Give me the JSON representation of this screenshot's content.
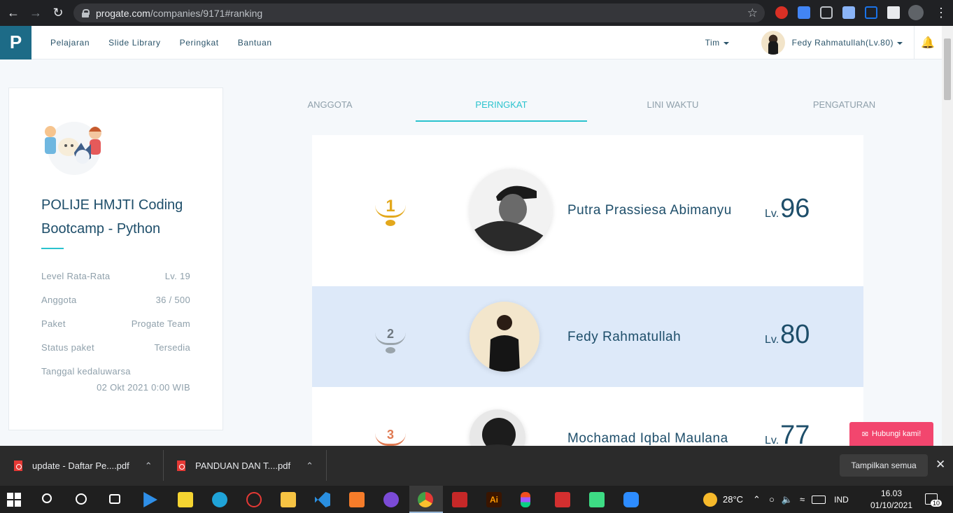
{
  "browser": {
    "url_host": "progate.com",
    "url_path": "/companies/9171#ranking"
  },
  "header": {
    "menu": [
      "Pelajaran",
      "Slide Library",
      "Peringkat",
      "Bantuan"
    ],
    "team_menu": "Tim",
    "user": "Fedy Rahmatullah(Lv.80)"
  },
  "sidebar": {
    "title": "POLIJE HMJTI Coding Bootcamp - Python",
    "info": [
      {
        "label": "Level Rata-Rata",
        "value": "Lv. 19"
      },
      {
        "label": "Anggota",
        "value": "36 / 500"
      },
      {
        "label": "Paket",
        "value": "Progate Team"
      },
      {
        "label": "Status paket",
        "value": "Tersedia"
      }
    ],
    "expiry_label": "Tanggal kedaluwarsa",
    "expiry_value": "02 Okt 2021 0:00 WIB"
  },
  "tabs": [
    "ANGGOTA",
    "PERINGKAT",
    "LINI WAKTU",
    "PENGATURAN"
  ],
  "active_tab": "PERINGKAT",
  "ranking": [
    {
      "rank": "1",
      "name": "Putra Prassiesa Abimanyu",
      "lv_label": "Lv.",
      "level": "96",
      "medal_color": "#e3a81c"
    },
    {
      "rank": "2",
      "name": "Fedy Rahmatullah",
      "lv_label": "Lv.",
      "level": "80",
      "medal_color": "#9aa4ab"
    },
    {
      "rank": "3",
      "name": "Mochamad Iqbal Maulana",
      "lv_label": "Lv.",
      "level": "77",
      "medal_color": "#e07a52"
    }
  ],
  "contact_button": "Hubungi kami!",
  "downloads": {
    "items": [
      "update - Daftar Pe....pdf",
      "PANDUAN DAN T....pdf"
    ],
    "show_all": "Tampilkan semua"
  },
  "taskbar": {
    "weather": "28°C",
    "lang": "IND",
    "time": "16.03",
    "date": "01/10/2021",
    "notif_count": "10"
  },
  "colors": {
    "accent": "#2bc3ce",
    "brand": "#1d6b87",
    "highlight_row": "#dde9f9",
    "contact": "#f2466e"
  }
}
